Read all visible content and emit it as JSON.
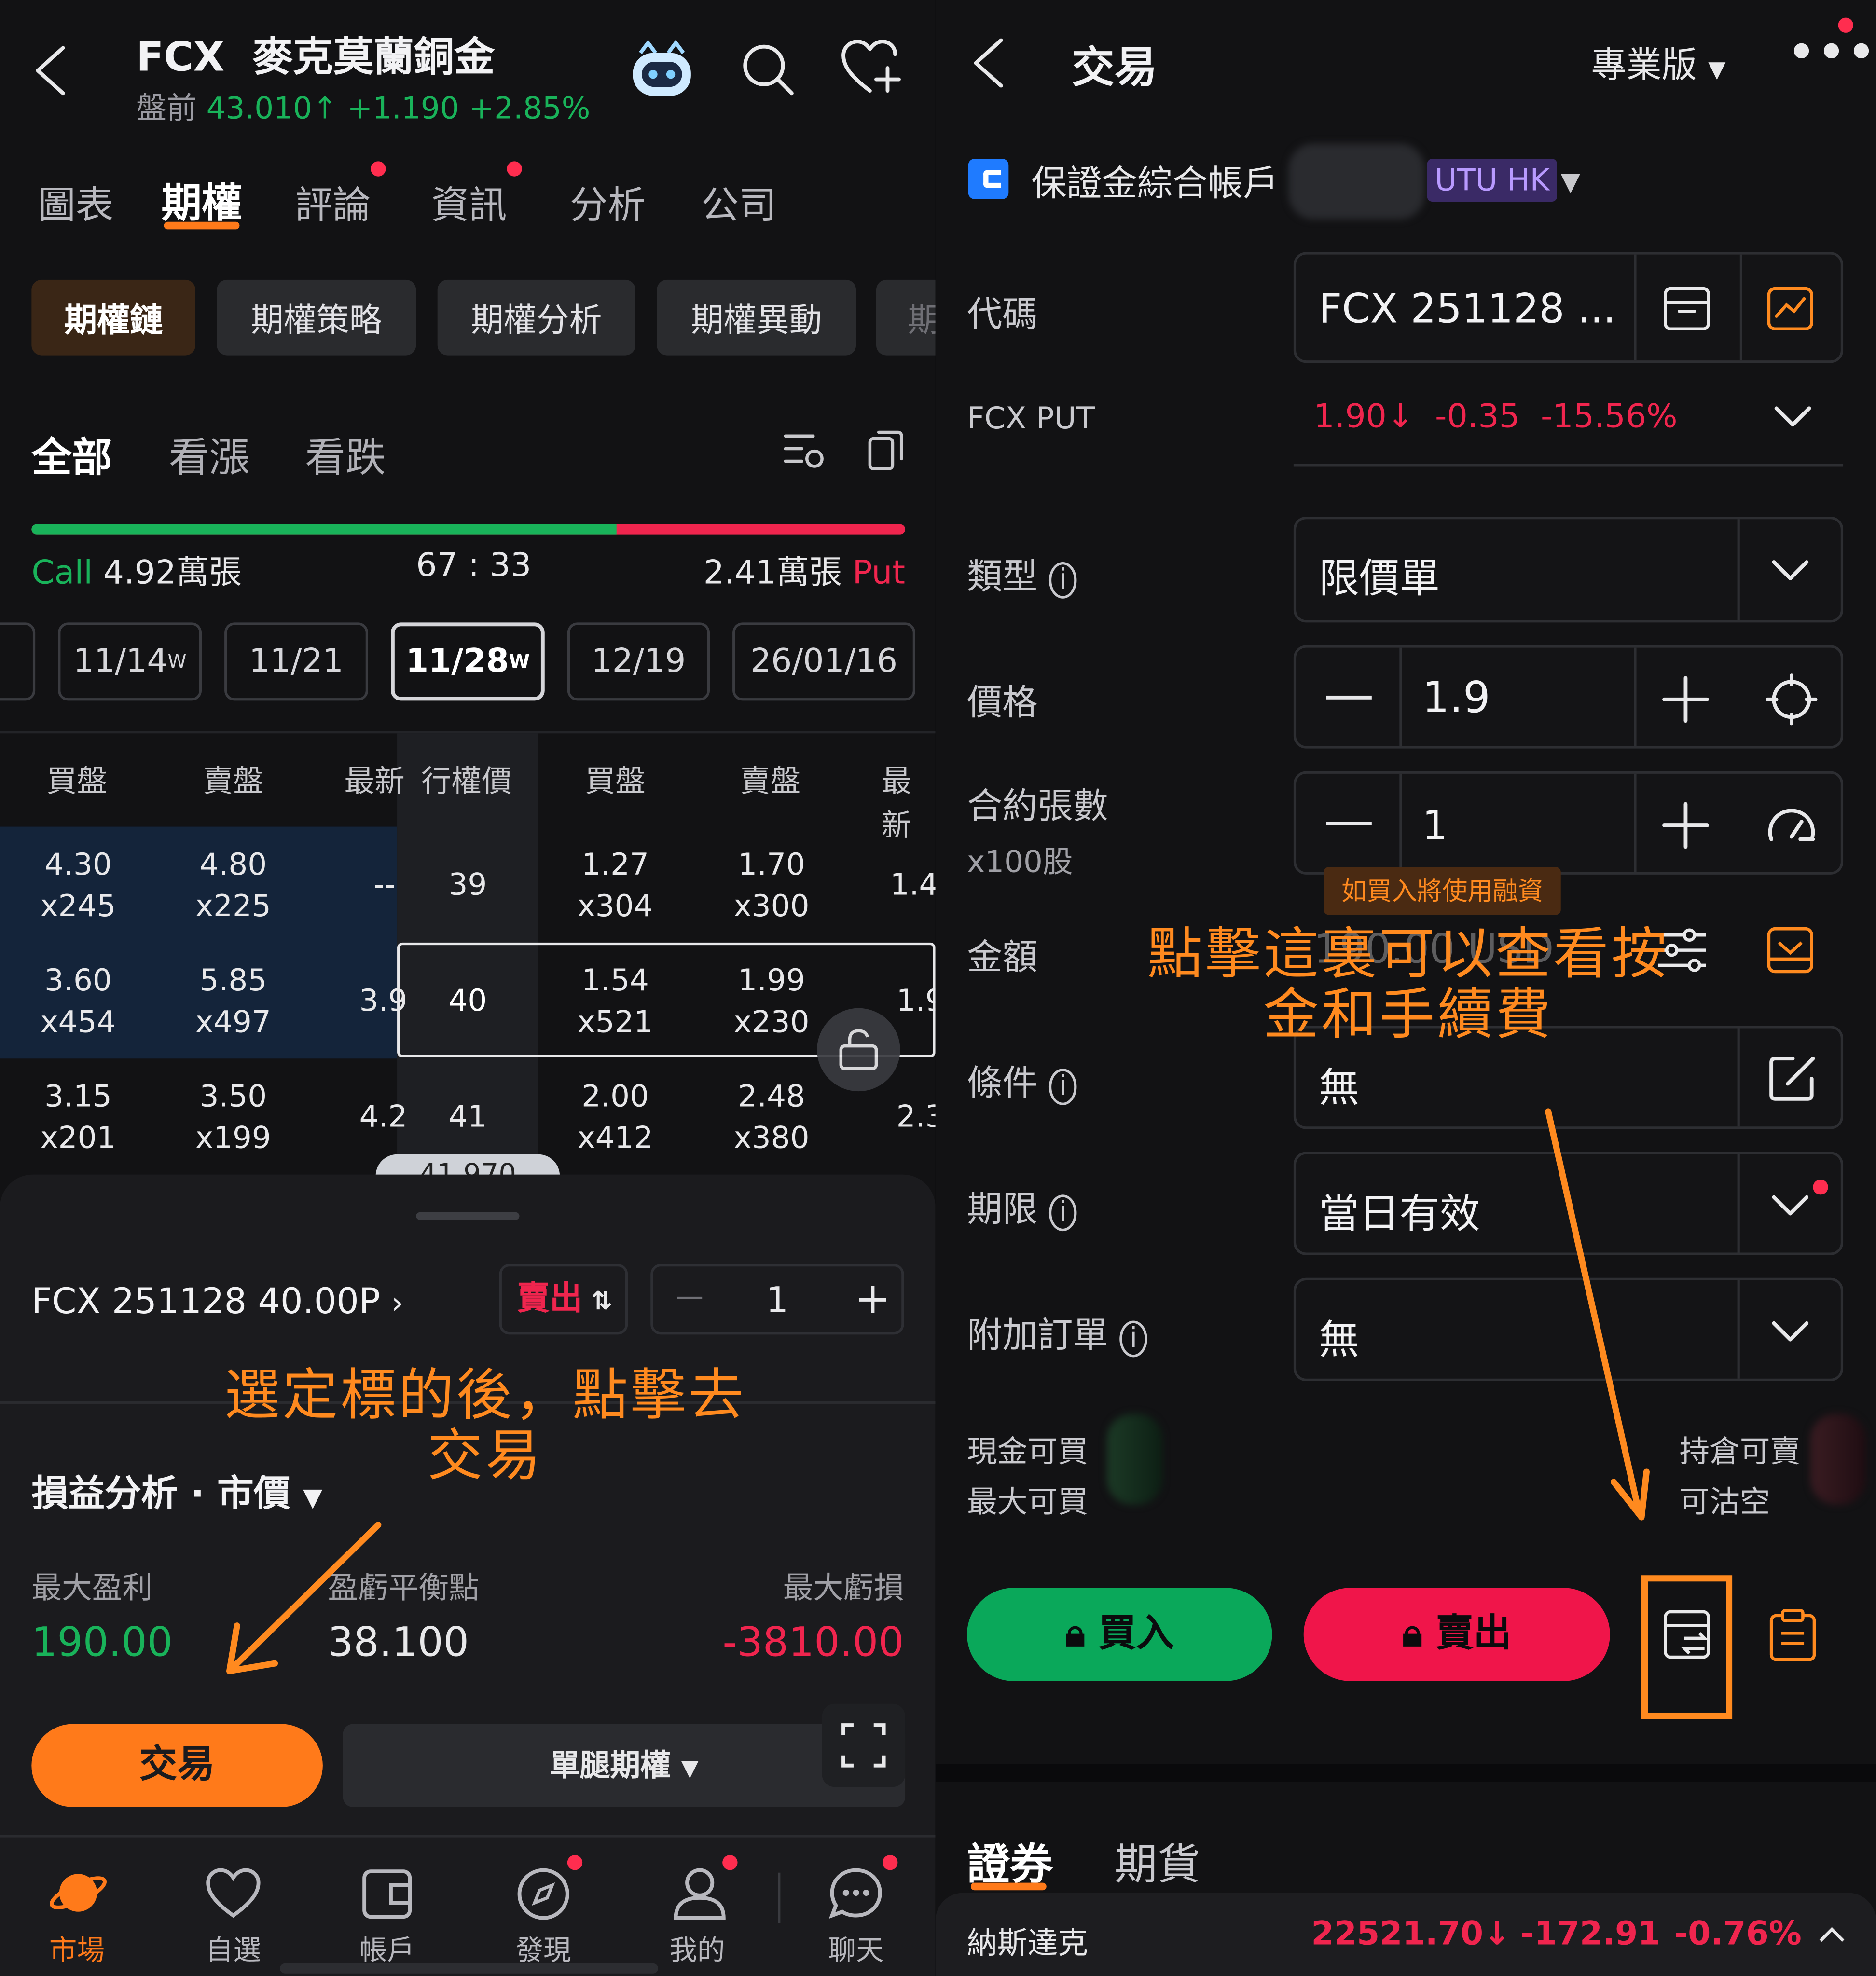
{
  "left": {
    "header": {
      "ticker": "FCX",
      "name": "麥克莫蘭銅金",
      "premarket_label": "盤前",
      "price": "43.010",
      "change": "+1.190",
      "change_pct": "+2.85%"
    },
    "tabs": [
      "圖表",
      "期權",
      "評論",
      "資訊",
      "分析",
      "公司"
    ],
    "chips": [
      "期權鏈",
      "期權策略",
      "期權分析",
      "期權異動",
      "期"
    ],
    "filters": [
      "全部",
      "看漲",
      "看跌"
    ],
    "ratio": {
      "call_label": "Call",
      "call_volume": "4.92萬張",
      "ratio": "67 : 33",
      "put_volume": "2.41萬張",
      "put_label": "Put",
      "call_share": 0.67
    },
    "dates": [
      "11/14",
      "11/21",
      "11/28",
      "12/19",
      "26/01/16"
    ],
    "date_sup": "W",
    "table_headers": [
      "買盤",
      "賣盤",
      "最新",
      "行權價",
      "買盤",
      "賣盤",
      "最新"
    ],
    "rows": [
      {
        "cb": "4.30",
        "cbq": "x245",
        "ca": "4.80",
        "caq": "x225",
        "cl": "--",
        "strike": "39",
        "pb": "1.27",
        "pbq": "x304",
        "pa": "1.70",
        "paq": "x300",
        "pl": "1.4"
      },
      {
        "cb": "3.60",
        "cbq": "x454",
        "ca": "5.85",
        "caq": "x497",
        "cl": "3.9",
        "strike": "40",
        "pb": "1.54",
        "pbq": "x521",
        "pa": "1.99",
        "paq": "x230",
        "pl": "1.9"
      },
      {
        "cb": "3.15",
        "cbq": "x201",
        "ca": "3.50",
        "caq": "x199",
        "cl": "4.2",
        "strike": "41",
        "pb": "2.00",
        "pbq": "x412",
        "pa": "2.48",
        "paq": "x380",
        "pl": "2.3"
      }
    ],
    "current_price_tag": "41.970",
    "sheet": {
      "contract": "FCX 251128 40.00P",
      "side": "賣出",
      "qty": "1",
      "minus": "—",
      "plus": "+",
      "pnl_title": "損益分析 · 市價",
      "max_profit_label": "最大盈利",
      "max_profit": "190.00",
      "breakeven_label": "盈虧平衡點",
      "breakeven": "38.100",
      "max_loss_label": "最大虧損",
      "max_loss": "-3810.00",
      "trade_btn": "交易",
      "leg_btn": "單腿期權"
    },
    "annotation": "選定標的後，點擊去\n交易",
    "tabbar": [
      "市場",
      "自選",
      "帳戶",
      "發現",
      "我的",
      "聊天"
    ]
  },
  "right": {
    "title": "交易",
    "mode": "專業版",
    "account": {
      "name": "保證金綜合帳戶",
      "broker": "UTU HK"
    },
    "fields": {
      "code_label": "代碼",
      "code_value": "FCX 251128 ...",
      "quote_label": "FCX PUT",
      "quote_price": "1.90",
      "quote_change": "-0.35",
      "quote_pct": "-15.56%",
      "type_label": "類型",
      "type_value": "限價單",
      "price_label": "價格",
      "price_value": "1.9",
      "qty_label": "合約張數",
      "qty_sub": "x100股",
      "qty_value": "1",
      "margin_tip": "如買入將使用融資",
      "amount_label": "金額",
      "amount_value": "190.00 USD",
      "cond_label": "條件",
      "cond_value": "無",
      "tif_label": "期限",
      "tif_value": "當日有效",
      "attach_label": "附加訂單",
      "attach_value": "無",
      "cash_buy": "現金可買",
      "max_buy": "最大可買",
      "pos_sell": "持倉可賣",
      "short_sell": "可沽空"
    },
    "buy_btn": "買入",
    "sell_btn": "賣出",
    "annotation": "點擊這裏可以查看按\n金和手續費",
    "bottom_tabs": [
      "證券",
      "期貨"
    ],
    "ticker": {
      "name": "納斯達克",
      "value": "22521.70",
      "change": "-172.91",
      "pct": "-0.76%"
    }
  }
}
